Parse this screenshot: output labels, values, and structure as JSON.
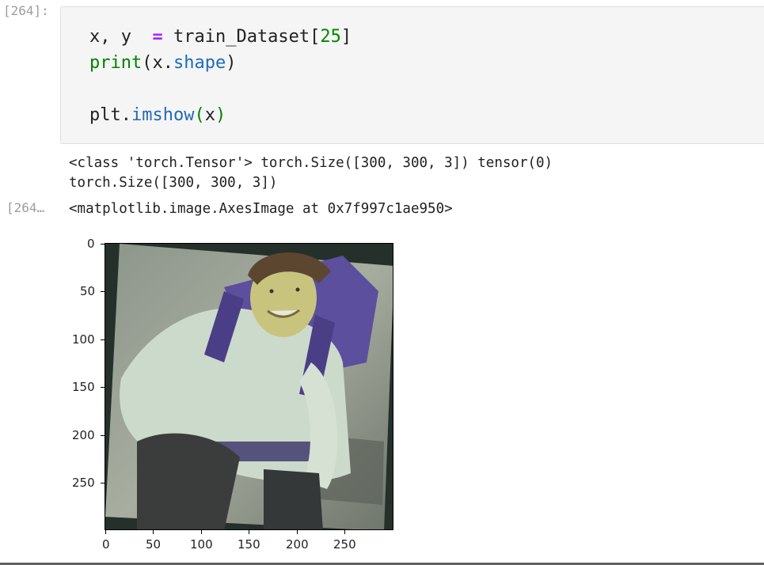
{
  "input_cell": {
    "prompt": "[264]:",
    "line1": {
      "a": "x, y  ",
      "op": "=",
      "b": " train_Dataset[",
      "num": "25",
      "c": "]"
    },
    "line2": {
      "fn": "print",
      "a": "(x.",
      "attr": "shape",
      "b": ")"
    },
    "line3": {
      "a": "plt.",
      "attr": "imshow",
      "p1": "(",
      "b": "x",
      "p2": ")"
    }
  },
  "stdout": {
    "line1": "<class 'torch.Tensor'> torch.Size([300, 300, 3]) tensor(0)",
    "line2": "torch.Size([300, 300, 3])"
  },
  "output_cell": {
    "prompt": "[264…",
    "repr": "<matplotlib.image.AxesImage at 0x7f997c1ae950>"
  },
  "chart_data": {
    "type": "heatmap",
    "title": "",
    "xlabel": "",
    "ylabel": "",
    "xlim": [
      0,
      300
    ],
    "ylim": [
      300,
      0
    ],
    "x_ticks": [
      "0",
      "50",
      "100",
      "150",
      "200",
      "250"
    ],
    "y_ticks": [
      "0",
      "50",
      "100",
      "150",
      "200",
      "250"
    ],
    "image_description_colors": {
      "background": "#2f3a30",
      "jacket": "#cfdccf",
      "backpack": "#5a4fa0",
      "hat": "#5e4630",
      "skin": "#c2c07a",
      "pants": "#3a3c3c"
    }
  }
}
